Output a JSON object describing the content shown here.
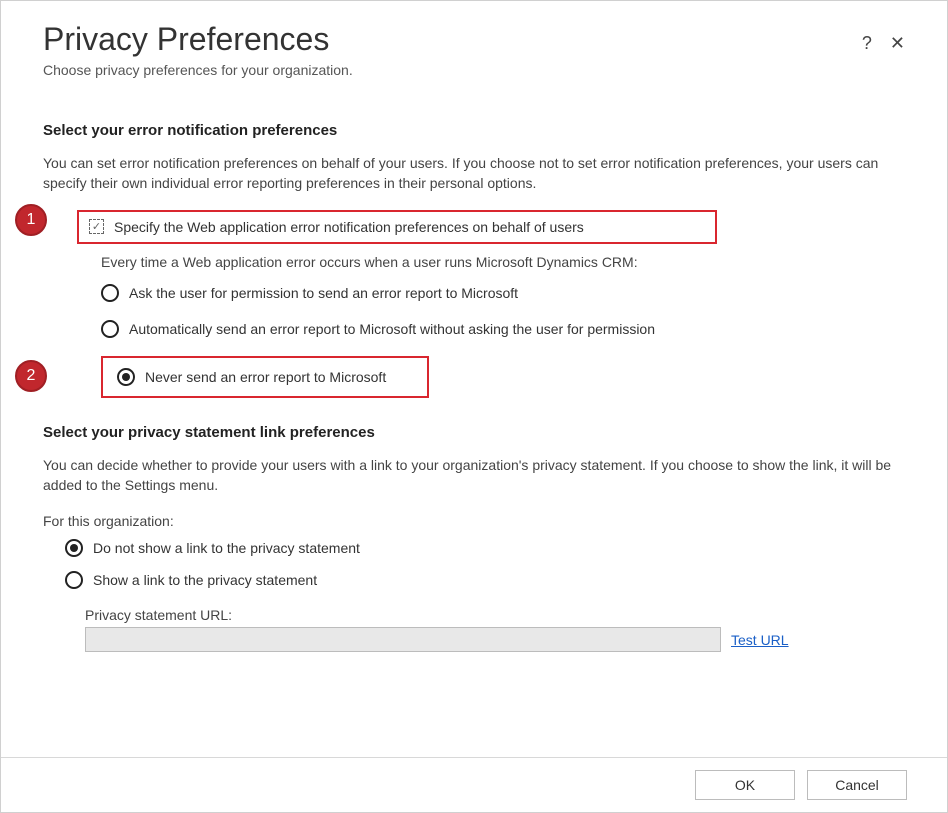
{
  "header": {
    "title": "Privacy Preferences",
    "subtitle": "Choose privacy preferences for your organization."
  },
  "section_error": {
    "heading": "Select your error notification preferences",
    "desc": "You can set error notification preferences on behalf of your users. If you choose not to set error notification preferences, your users can specify their own individual error reporting preferences in their personal options.",
    "checkbox_label": "Specify the Web application error notification preferences on behalf of users",
    "sub_text": "Every time a Web application error occurs when a user runs Microsoft Dynamics CRM:",
    "options": {
      "ask": "Ask the user for permission to send an error report to Microsoft",
      "auto": "Automatically send an error report to Microsoft without asking the user for permission",
      "never": "Never send an error report to Microsoft"
    }
  },
  "section_privacy": {
    "heading": "Select your privacy statement link preferences",
    "desc": "You can decide whether to provide your users with a link to your organization's privacy statement. If you choose to show the link, it will be added to the Settings menu.",
    "for_org": "For this organization:",
    "options": {
      "no_show": "Do not show a link to the privacy statement",
      "show": "Show a link to the privacy statement"
    },
    "url_label": "Privacy statement URL:",
    "url_value": "",
    "test_link": "Test URL"
  },
  "annotations": {
    "badge1": "1",
    "badge2": "2"
  },
  "footer": {
    "ok": "OK",
    "cancel": "Cancel"
  }
}
